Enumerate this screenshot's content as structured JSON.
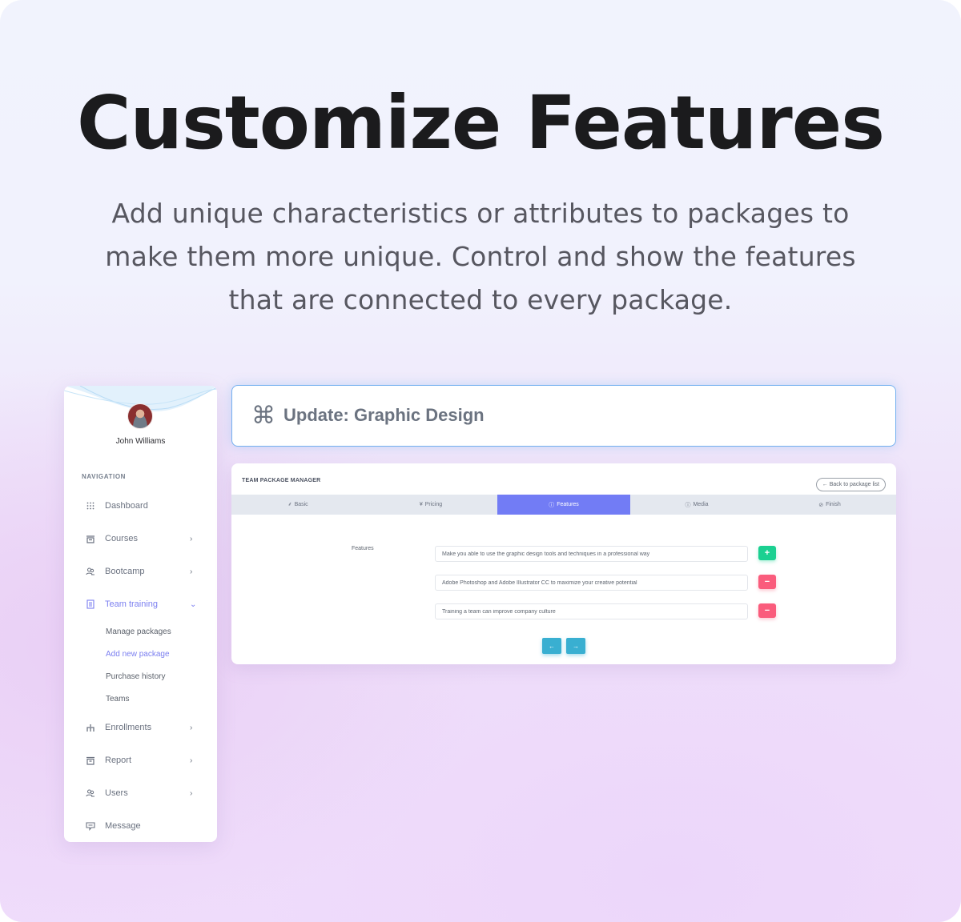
{
  "hero": {
    "title": "Customize Features",
    "subtitle": "Add unique characteristics or attributes to packages to make them more unique. Control and show the features that are connected to every package."
  },
  "sidebar": {
    "user_name": "John Williams",
    "nav_heading": "NAVIGATION",
    "items": [
      {
        "label": "Dashboard",
        "icon": "grid-icon",
        "has_chevron": false
      },
      {
        "label": "Courses",
        "icon": "inbox-icon",
        "has_chevron": true
      },
      {
        "label": "Bootcamp",
        "icon": "users-icon",
        "has_chevron": true
      },
      {
        "label": "Team training",
        "icon": "document-icon",
        "has_chevron": true,
        "expanded": true,
        "active": true
      },
      {
        "label": "Enrollments",
        "icon": "sitemap-icon",
        "has_chevron": true
      },
      {
        "label": "Report",
        "icon": "archive-icon",
        "has_chevron": true
      },
      {
        "label": "Users",
        "icon": "users-icon",
        "has_chevron": true
      },
      {
        "label": "Message",
        "icon": "chat-icon",
        "has_chevron": false
      }
    ],
    "sub_items": [
      {
        "label": "Manage packages"
      },
      {
        "label": "Add new package",
        "active": true
      },
      {
        "label": "Purchase history"
      },
      {
        "label": "Teams"
      }
    ],
    "chevron_right": "›",
    "chevron_down": "⌄"
  },
  "title_card": {
    "icon": "⌘",
    "title": "Update: Graphic Design"
  },
  "panel": {
    "title": "TEAM PACKAGE MANAGER",
    "back_button": "← Back to package list",
    "tabs": [
      {
        "icon": "⸙",
        "label": "Basic"
      },
      {
        "icon": "¥",
        "label": "Pricing"
      },
      {
        "icon": "ⓘ",
        "label": "Features",
        "active": true
      },
      {
        "icon": "ⓘ",
        "label": "Media"
      },
      {
        "icon": "⊘",
        "label": "Finish"
      }
    ],
    "features_label": "Features",
    "features": [
      {
        "value": "Make you able to use the graphic design tools and techniques in a professional way",
        "button": "+"
      },
      {
        "value": "Adobe Photoshop and Adobe Illustrator CC to maximize your creative potential",
        "button": "−"
      },
      {
        "value": "Training a team can improve company culture",
        "button": "−"
      }
    ],
    "prev_button": "←",
    "next_button": "→"
  },
  "colors": {
    "accent": "#727cf5",
    "success": "#1bd091",
    "danger": "#fa5c7c",
    "info": "#39afd1",
    "title_border": "#74b0ef"
  }
}
